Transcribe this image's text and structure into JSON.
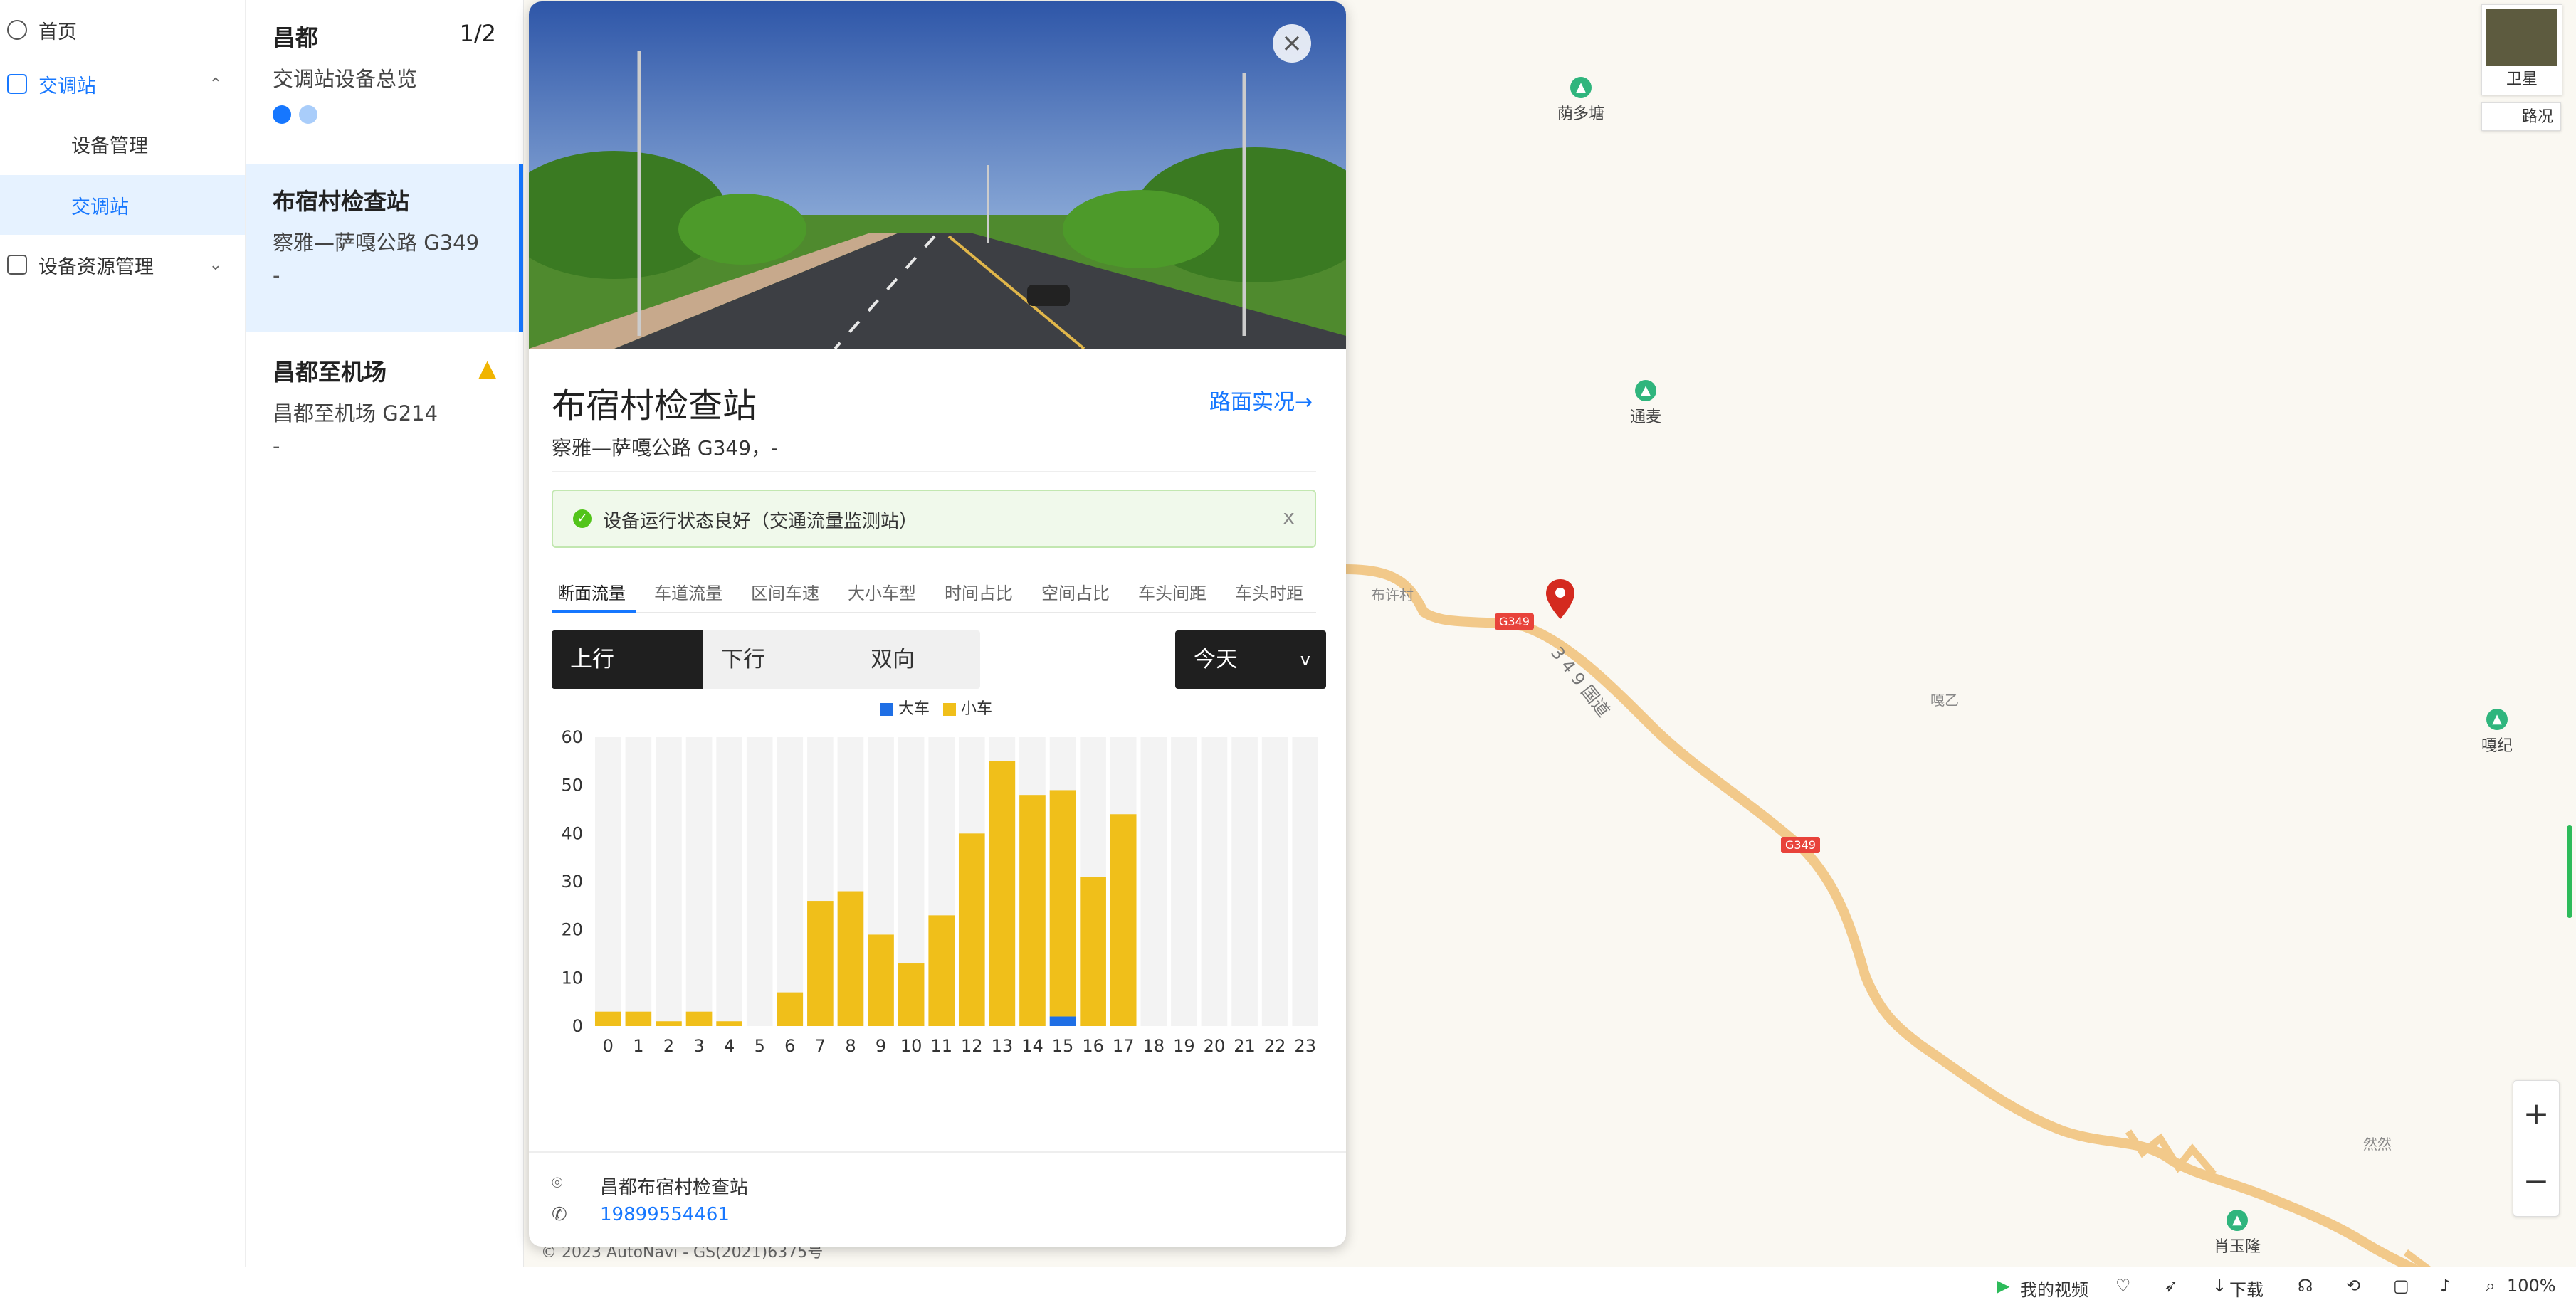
{
  "sidebar": {
    "items": [
      {
        "label": "首页"
      },
      {
        "label": "交调站",
        "children": [
          {
            "label": "设备管理"
          },
          {
            "label": "交调站"
          }
        ]
      },
      {
        "label": "设备资源管理"
      }
    ]
  },
  "stations": {
    "summary": {
      "title": "昌都",
      "pager": "1/2",
      "subtitle": "交调站设备总览"
    },
    "cards": [
      {
        "title": "布宿村检查站",
        "road": "察雅—萨嘎公路 G349",
        "detail": "-"
      },
      {
        "title": "昌都至机场",
        "road": "昌都至机场 G214",
        "detail": "-"
      }
    ]
  },
  "popup": {
    "close": "×",
    "title": "布宿村检查站",
    "subtitle": "察雅—萨嘎公路 G349，-",
    "live_link": "路面实况→",
    "status": "设备运行状态良好（交通流量监测站）",
    "status_close": "x",
    "tabs": [
      "断面流量",
      "车道流量",
      "区间车速",
      "大小车型",
      "时间占比",
      "空间占比",
      "车头间距",
      "车头时距"
    ],
    "direction": [
      "上行",
      "下行",
      "双向"
    ],
    "period": "今天",
    "period_arrow": "v",
    "address": "昌都布宿村检查站",
    "phone": "19899554461"
  },
  "chart_data": {
    "type": "bar",
    "stacked": true,
    "categories": [
      "0",
      "1",
      "2",
      "3",
      "4",
      "5",
      "6",
      "7",
      "8",
      "9",
      "10",
      "11",
      "12",
      "13",
      "14",
      "15",
      "16",
      "17",
      "18",
      "19",
      "20",
      "21",
      "22",
      "23"
    ],
    "series": [
      {
        "name": "大车",
        "color": "#1f6fe5",
        "values": [
          0,
          0,
          0,
          0,
          0,
          0,
          0,
          0,
          0,
          0,
          0,
          0,
          0,
          0,
          0,
          2,
          0,
          0,
          0,
          0,
          0,
          0,
          0,
          0
        ]
      },
      {
        "name": "小车",
        "color": "#f0bf1a",
        "values": [
          3,
          3,
          1,
          3,
          1,
          0,
          7,
          26,
          28,
          19,
          13,
          23,
          40,
          55,
          48,
          47,
          31,
          44,
          0,
          0,
          0,
          0,
          0,
          0
        ]
      }
    ],
    "ylim": [
      0,
      60
    ],
    "yticks": [
      0,
      10,
      20,
      30,
      40,
      50,
      60
    ],
    "legend": "top-center",
    "grid": false
  },
  "map": {
    "pois": [
      "荫多塘",
      "通麦",
      "嘎纪",
      "肖玉隆"
    ],
    "labels": [
      "布许村",
      "嘎乙",
      "然然",
      "3 4 9 国道"
    ],
    "road_badges": [
      "G349",
      "G349"
    ],
    "copyright": "© 2023 AutoNavi - GS(2021)6375号",
    "layers": [
      "卫星",
      "路况"
    ],
    "zoom_in": "+",
    "zoom_out": "−"
  },
  "bottombar": {
    "items": [
      "我的视频",
      "下载",
      "100%"
    ]
  },
  "colors": {
    "accent": "#1677ff",
    "bar_small": "#f0bf1a",
    "bar_large": "#1f6fe5",
    "road": "#f2c98a",
    "dark_btn": "#1f1f1f"
  }
}
